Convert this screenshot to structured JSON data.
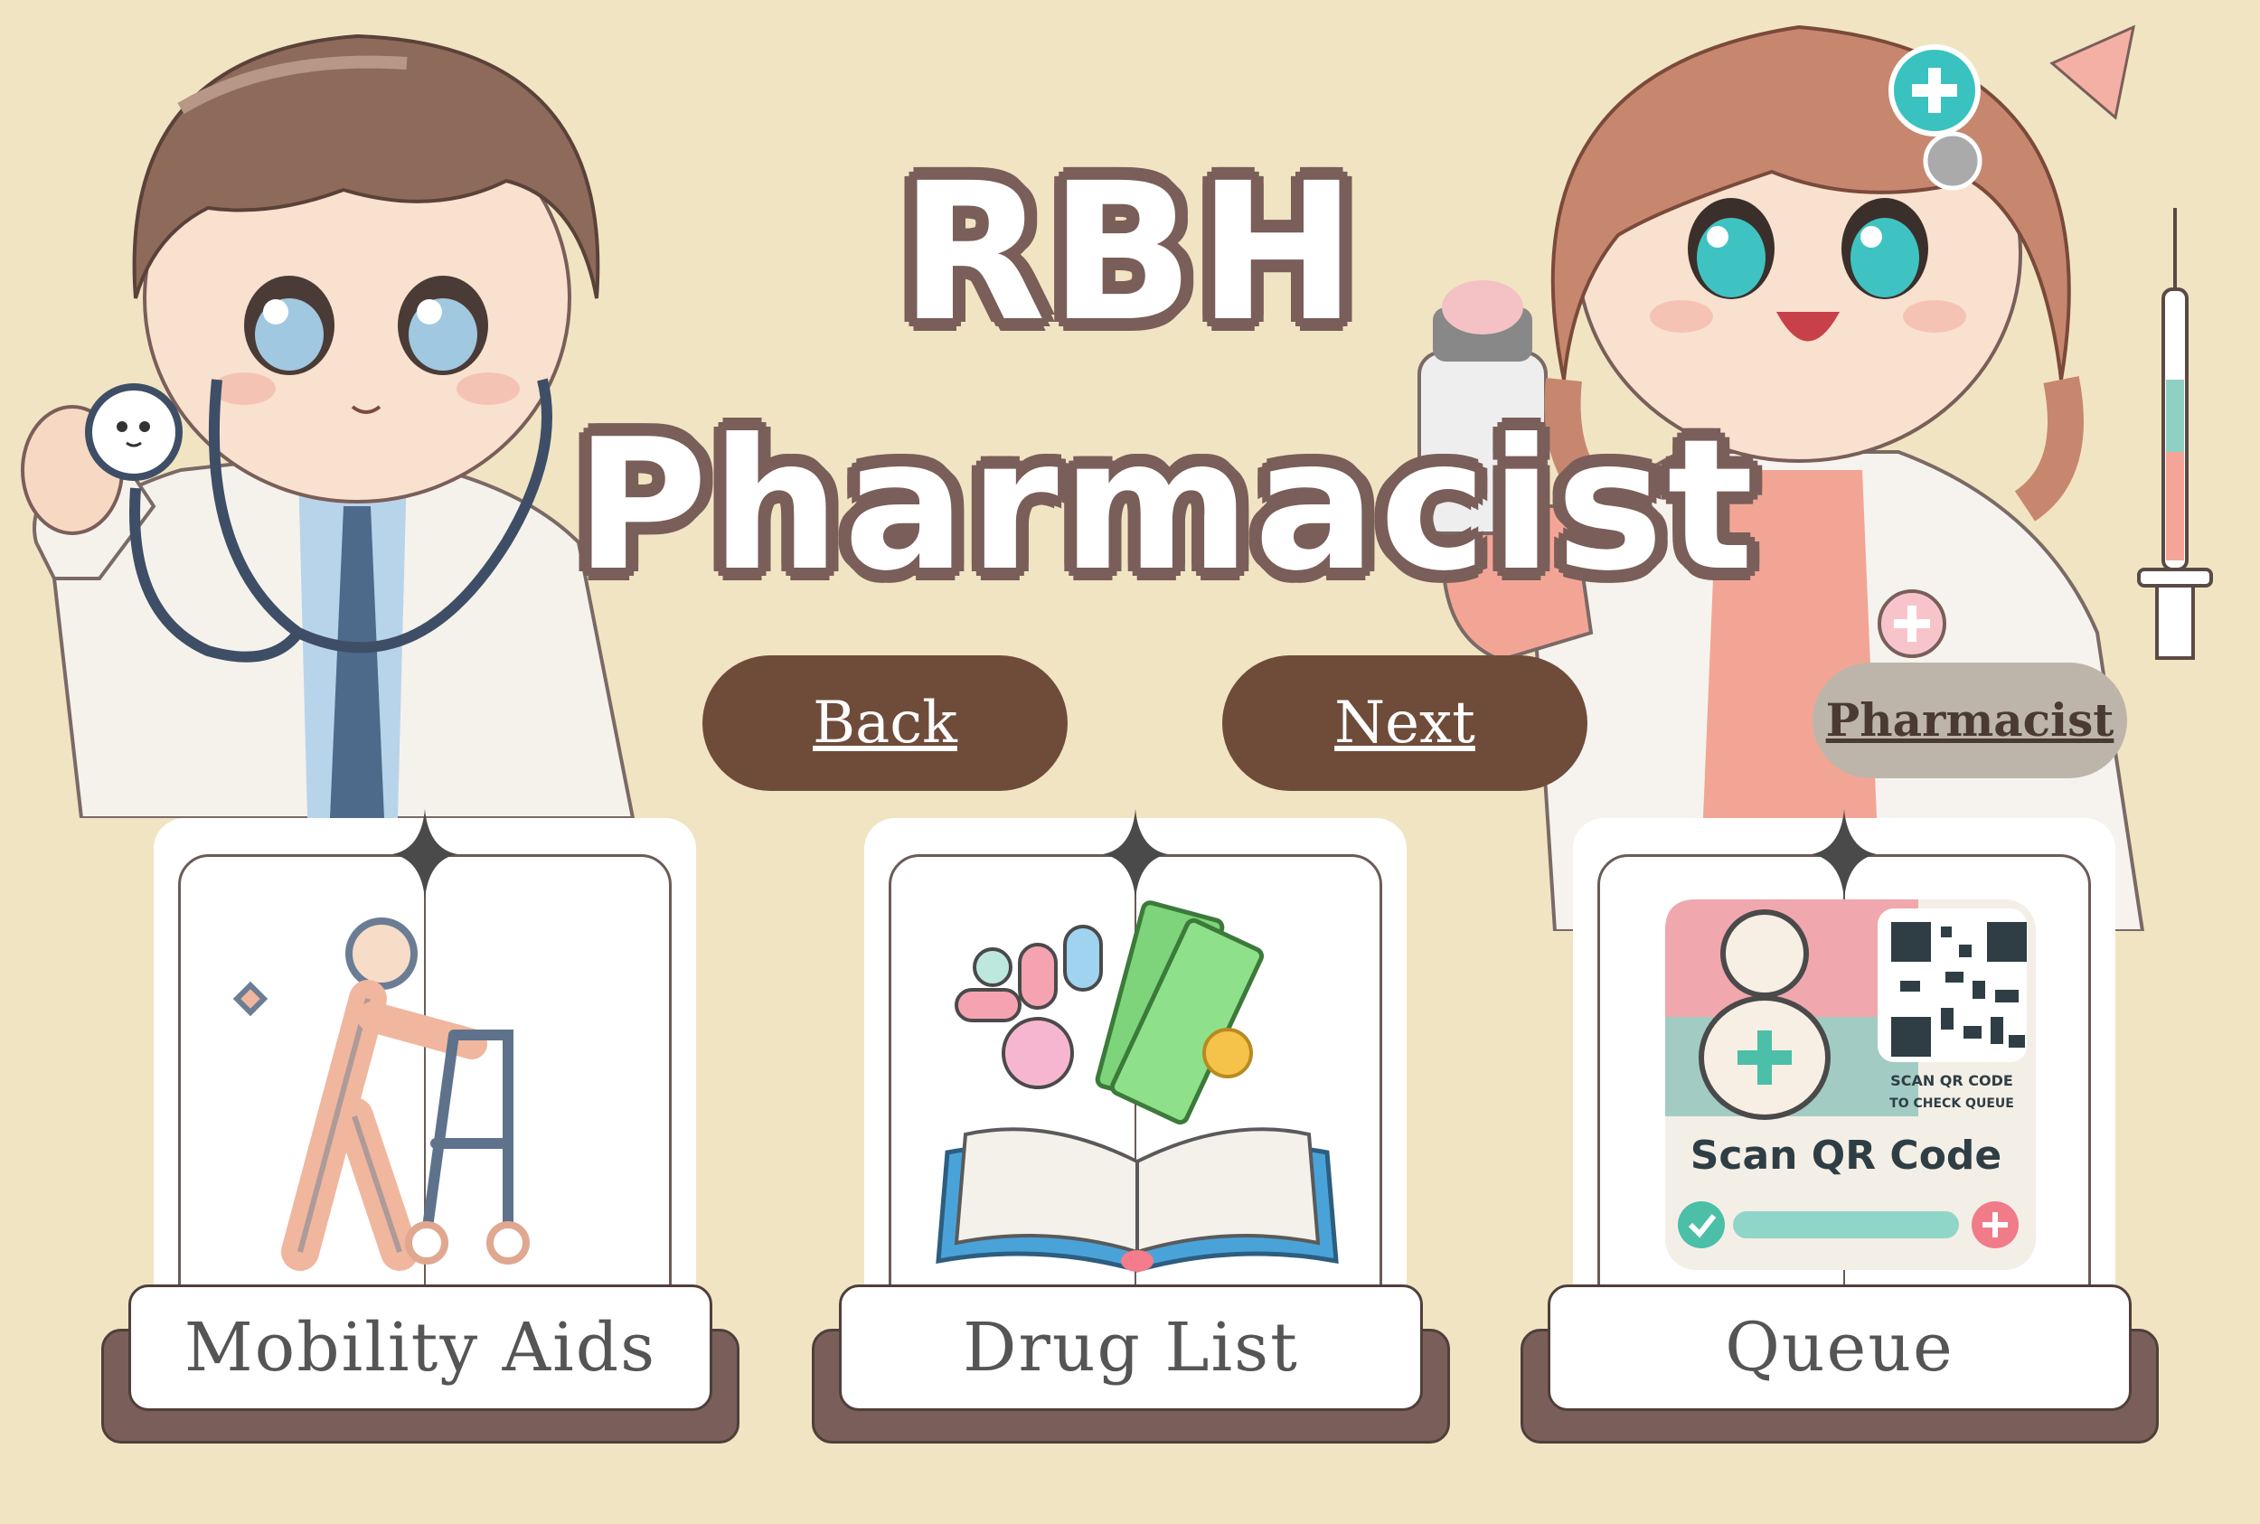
{
  "title": {
    "line1": "RBH",
    "line2": "Pharmacist"
  },
  "nav": {
    "back_label": "Back",
    "next_label": "Next",
    "pharmacist_label": "Pharmacist"
  },
  "cards": [
    {
      "label": "Mobility Aids",
      "icon": "walker-person-icon"
    },
    {
      "label": "Drug List",
      "icon": "book-pills-money-icon"
    },
    {
      "label": "Queue",
      "icon": "qr-code-icon",
      "qr_caption": "SCAN QR CODE TO CHECK QUEUE",
      "qr_title": "Scan QR Code"
    }
  ],
  "colors": {
    "background": "#f1e4c3",
    "button": "#6f4c3a",
    "title_outline": "#7a5e59",
    "pharmacist_button": "#bdb5a9"
  }
}
